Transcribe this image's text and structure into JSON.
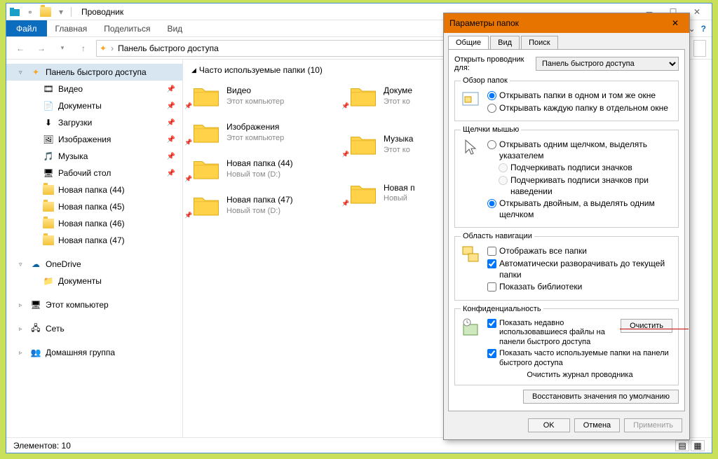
{
  "window": {
    "title": "Проводник"
  },
  "ribbon": {
    "file": "Файл",
    "tabs": [
      "Главная",
      "Поделиться",
      "Вид"
    ]
  },
  "path": {
    "current": "Панель быстрого доступа"
  },
  "sidebar": {
    "quick": {
      "label": "Панель быстрого доступа"
    },
    "pinned": [
      {
        "label": "Видео"
      },
      {
        "label": "Документы"
      },
      {
        "label": "Загрузки"
      },
      {
        "label": "Изображения"
      },
      {
        "label": "Музыка"
      },
      {
        "label": "Рабочий стол"
      },
      {
        "label": "Новая папка (44)"
      },
      {
        "label": "Новая папка (45)"
      },
      {
        "label": "Новая папка (46)"
      },
      {
        "label": "Новая папка (47)"
      }
    ],
    "onedrive": {
      "label": "OneDrive",
      "child": "Документы"
    },
    "thispc": {
      "label": "Этот компьютер"
    },
    "network": {
      "label": "Сеть"
    },
    "homegroup": {
      "label": "Домашняя группа"
    }
  },
  "content": {
    "group_title": "Часто используемые папки (10)",
    "folders_left": [
      {
        "name": "Видео",
        "sub": "Этот компьютер"
      },
      {
        "name": "Изображения",
        "sub": "Этот компьютер"
      },
      {
        "name": "Новая папка (44)",
        "sub": "Новый том (D:)"
      },
      {
        "name": "Новая папка (47)",
        "sub": "Новый том (D:)"
      }
    ],
    "folders_right": [
      {
        "name": "Докуме",
        "sub": "Этот ко"
      },
      {
        "name": "Музыка",
        "sub": "Этот ко"
      },
      {
        "name": "Новая п",
        "sub": "Новый"
      }
    ]
  },
  "statusbar": {
    "items": "Элементов: 10"
  },
  "dialog": {
    "title": "Параметры папок",
    "tabs": [
      "Общие",
      "Вид",
      "Поиск"
    ],
    "open_label": "Открыть проводник для:",
    "open_value": "Панель быстрого доступа",
    "browse": {
      "legend": "Обзор папок",
      "opt1": "Открывать папки в одном и том же окне",
      "opt2": "Открывать каждую папку в отдельном окне"
    },
    "click": {
      "legend": "Щелчки мышью",
      "opt1": "Открывать одним щелчком, выделять указателем",
      "sub1": "Подчеркивать подписи значков",
      "sub2": "Подчеркивать подписи значков при наведении",
      "opt2": "Открывать двойным, а выделять одним щелчком"
    },
    "nav": {
      "legend": "Область навигации",
      "opt1": "Отображать все папки",
      "opt2": "Автоматически разворачивать до текущей папки",
      "opt3": "Показать библиотеки"
    },
    "privacy": {
      "legend": "Конфиденциальность",
      "opt1": "Показать недавно использовавшиеся файлы на панели быстрого доступа",
      "opt2": "Показать часто используемые папки на панели быстрого доступа",
      "clear_label": "Очистить журнал проводника",
      "clear_btn": "Очистить"
    },
    "restore": "Восстановить значения по умолчанию",
    "ok": "OK",
    "cancel": "Отмена",
    "apply": "Применить"
  }
}
